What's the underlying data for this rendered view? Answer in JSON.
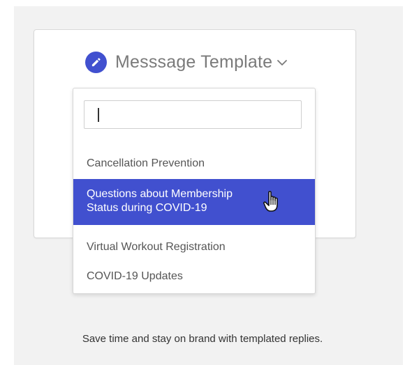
{
  "header": {
    "title": "Messsage Template",
    "icon": "pencil-icon",
    "accent_color": "#4150cf"
  },
  "dropdown": {
    "search_value": "",
    "options": [
      {
        "label": "Cancellation Prevention",
        "selected": false
      },
      {
        "label": "Questions about Membership Status during COVID-19",
        "line1": "Questions about Membership",
        "line2": "Status during COVID-19",
        "selected": true
      },
      {
        "label": "Virtual Workout Registration",
        "selected": false
      },
      {
        "label": "COVID-19 Updates",
        "selected": false
      }
    ]
  },
  "footer": {
    "tagline": "Save time and stay on brand with templated replies."
  }
}
